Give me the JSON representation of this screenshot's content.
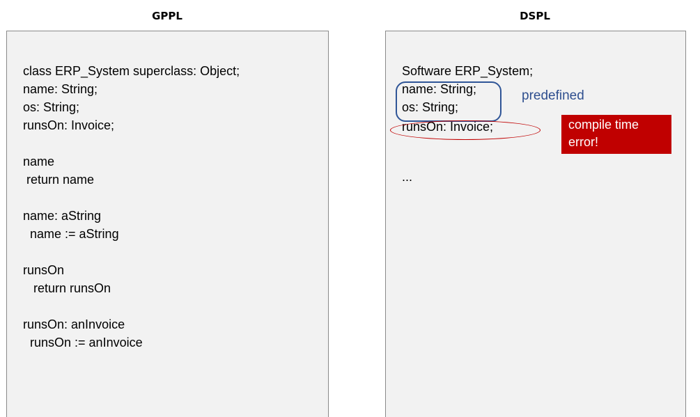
{
  "gppl": {
    "title": "GPPL",
    "code_blocks": [
      [
        "class ERP_System superclass: Object;",
        "name: String;",
        "os: String;",
        "runsOn: Invoice;"
      ],
      [
        "name",
        " return name"
      ],
      [
        "name: aString",
        "  name := aString"
      ],
      [
        "runsOn",
        "   return runsOn"
      ],
      [
        "runsOn: anInvoice",
        "  runsOn := anInvoice"
      ]
    ]
  },
  "dspl": {
    "title": "DSPL",
    "line1": "Software ERP_System;",
    "line2": "name: String;",
    "line3": "os: String;",
    "line4": "runsOn: Invoice;",
    "line5": "...",
    "predefined_label": "predefined",
    "error_label": "compile time error!"
  },
  "colors": {
    "panel_bg": "#f2f2f2",
    "predefined_blue": "#2f5597",
    "error_red": "#c00000"
  }
}
